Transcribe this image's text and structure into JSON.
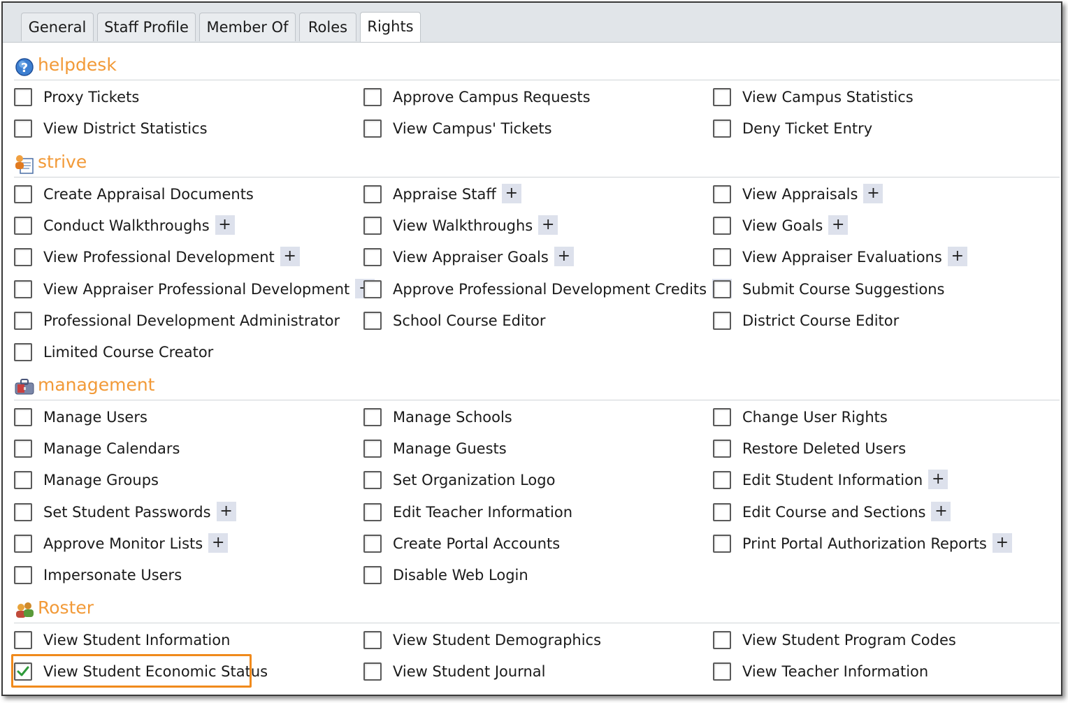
{
  "tabs": [
    {
      "label": "General",
      "active": false
    },
    {
      "label": "Staff Profile",
      "active": false
    },
    {
      "label": "Member Of",
      "active": false
    },
    {
      "label": "Roles",
      "active": false
    },
    {
      "label": "Rights",
      "active": true
    }
  ],
  "colors": {
    "section_title": "#f29a38",
    "highlight": "#f08a1c",
    "plus_bg": "#dde1ec"
  },
  "sections": [
    {
      "title": "helpdesk",
      "icon": "help-question-icon",
      "items": [
        {
          "label": "Proxy Tickets",
          "checked": false,
          "expandable": false
        },
        {
          "label": "Approve Campus Requests",
          "checked": false,
          "expandable": false
        },
        {
          "label": "View Campus Statistics",
          "checked": false,
          "expandable": false
        },
        {
          "label": "View District Statistics",
          "checked": false,
          "expandable": false
        },
        {
          "label": "View Campus' Tickets",
          "checked": false,
          "expandable": false
        },
        {
          "label": "Deny Ticket Entry",
          "checked": false,
          "expandable": false
        }
      ]
    },
    {
      "title": "strive",
      "icon": "document-person-icon",
      "items": [
        {
          "label": "Create Appraisal Documents",
          "checked": false,
          "expandable": false
        },
        {
          "label": "Appraise Staff",
          "checked": false,
          "expandable": true
        },
        {
          "label": "View Appraisals",
          "checked": false,
          "expandable": true
        },
        {
          "label": "Conduct Walkthroughs",
          "checked": false,
          "expandable": true
        },
        {
          "label": "View Walkthroughs",
          "checked": false,
          "expandable": true
        },
        {
          "label": "View Goals",
          "checked": false,
          "expandable": true
        },
        {
          "label": "View Professional Development",
          "checked": false,
          "expandable": true
        },
        {
          "label": "View Appraiser Goals",
          "checked": false,
          "expandable": true
        },
        {
          "label": "View Appraiser Evaluations",
          "checked": false,
          "expandable": true
        },
        {
          "label": "View Appraiser Professional Development",
          "checked": false,
          "expandable": true
        },
        {
          "label": "Approve Professional Development Credits",
          "checked": false,
          "expandable": true
        },
        {
          "label": "Submit Course Suggestions",
          "checked": false,
          "expandable": false
        },
        {
          "label": "Professional Development Administrator",
          "checked": false,
          "expandable": false
        },
        {
          "label": "School Course Editor",
          "checked": false,
          "expandable": false
        },
        {
          "label": "District Course Editor",
          "checked": false,
          "expandable": false
        },
        {
          "label": "Limited Course Creator",
          "checked": false,
          "expandable": false
        }
      ]
    },
    {
      "title": "management",
      "icon": "toolbox-icon",
      "items": [
        {
          "label": "Manage Users",
          "checked": false,
          "expandable": false
        },
        {
          "label": "Manage Schools",
          "checked": false,
          "expandable": false
        },
        {
          "label": "Change User Rights",
          "checked": false,
          "expandable": false
        },
        {
          "label": "Manage Calendars",
          "checked": false,
          "expandable": false
        },
        {
          "label": "Manage Guests",
          "checked": false,
          "expandable": false
        },
        {
          "label": "Restore Deleted Users",
          "checked": false,
          "expandable": false
        },
        {
          "label": "Manage Groups",
          "checked": false,
          "expandable": false
        },
        {
          "label": "Set Organization Logo",
          "checked": false,
          "expandable": false
        },
        {
          "label": "Edit Student Information",
          "checked": false,
          "expandable": true
        },
        {
          "label": "Set Student Passwords",
          "checked": false,
          "expandable": true
        },
        {
          "label": "Edit Teacher Information",
          "checked": false,
          "expandable": false
        },
        {
          "label": "Edit Course and Sections",
          "checked": false,
          "expandable": true
        },
        {
          "label": "Approve Monitor Lists",
          "checked": false,
          "expandable": true
        },
        {
          "label": "Create Portal Accounts",
          "checked": false,
          "expandable": false
        },
        {
          "label": "Print Portal Authorization Reports",
          "checked": false,
          "expandable": true
        },
        {
          "label": "Impersonate Users",
          "checked": false,
          "expandable": false
        },
        {
          "label": "Disable Web Login",
          "checked": false,
          "expandable": false
        }
      ]
    },
    {
      "title": "Roster",
      "icon": "people-group-icon",
      "items": [
        {
          "label": "View Student Information",
          "checked": false,
          "expandable": false
        },
        {
          "label": "View Student Demographics",
          "checked": false,
          "expandable": false
        },
        {
          "label": "View Student Program Codes",
          "checked": false,
          "expandable": false
        },
        {
          "label": "View Student Economic Status",
          "checked": true,
          "expandable": false,
          "highlighted": true
        },
        {
          "label": "View Student Journal",
          "checked": false,
          "expandable": false
        },
        {
          "label": "View Teacher Information",
          "checked": false,
          "expandable": false
        }
      ]
    }
  ],
  "plus_symbol": "+"
}
